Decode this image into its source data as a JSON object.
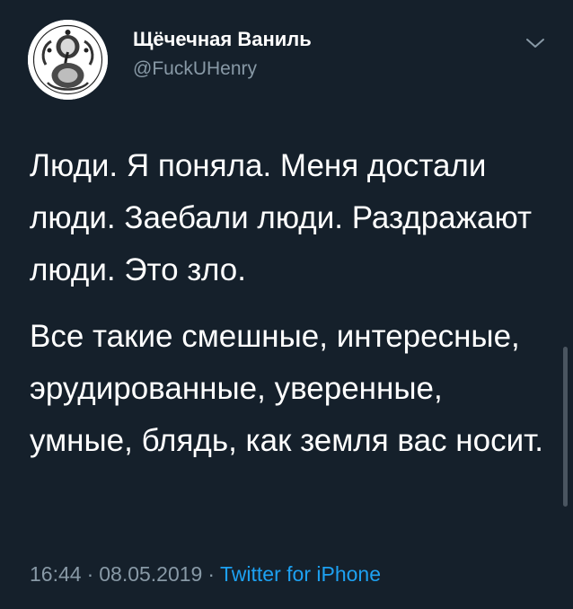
{
  "user": {
    "display_name": "Щёчечная Ваниль",
    "handle": "@FuckUHenry",
    "avatar_icon": "ganesha-illustration-icon"
  },
  "menu_icon": "chevron-down-icon",
  "tweet": {
    "paragraphs": [
      "Люди. Я поняла. Меня достали люди. Заебали люди. Раздражают люди. Это зло.",
      "Все такие смешные, интересные, эрудированные, уверенные, умные, блядь, как земля вас носит."
    ],
    "time": "16:44",
    "date": "08.05.2019",
    "separator": "·",
    "source": "Twitter for iPhone"
  },
  "colors": {
    "background": "#15202b",
    "text": "#ffffff",
    "secondary": "#8899a6",
    "accent": "#1da1f2"
  }
}
